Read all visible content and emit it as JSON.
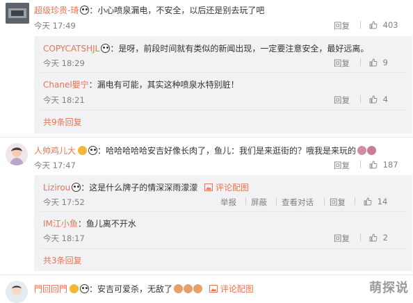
{
  "comments": [
    {
      "user": "超级珍贵-琦",
      "text": "：小心喷泉漏电，不安全，以后还是别去玩了吧",
      "time": "今天 17:49",
      "reply_label": "回复",
      "likes": "403",
      "replies": [
        {
          "user": "COPYCATSHJL",
          "text": "：是呀，前段时间就有类似的新闻出现，一定要注意安全，最好远离。",
          "time": "今天 18:29",
          "reply_label": "回复",
          "likes": "9"
        },
        {
          "user": "Chanel嬰宁",
          "text": "：漏电有可能，其实这种喷泉水特别脏！",
          "time": "今天 18:21",
          "reply_label": "回复",
          "likes": "4"
        }
      ],
      "more": "共9条回复"
    },
    {
      "user": "人帅鸡儿大",
      "text": "：哈哈哈哈哈安吉好像长肉了，鱼儿：我们是来逛街的？哦我是来玩的",
      "time": "今天 17:47",
      "reply_label": "回复",
      "likes": "187",
      "replies": [
        {
          "user": "Lizirou",
          "text": "：这是什么牌子的情深深雨濛濛",
          "extra_link": "评论配图",
          "time": "今天 17:52",
          "actions": [
            "举报",
            "屏蔽",
            "查看对话",
            "回复"
          ],
          "likes": "14"
        },
        {
          "user": "IM江小鱼",
          "text": "：鱼儿离不开水",
          "time": "今天 18:17",
          "reply_label": "回复",
          "likes": "2"
        }
      ],
      "more": "共3条回复"
    },
    {
      "user": "門回回門",
      "text": "：安吉可爱杀，无敌了",
      "extra_link": "评论配图"
    }
  ],
  "watermark": "萌探说"
}
